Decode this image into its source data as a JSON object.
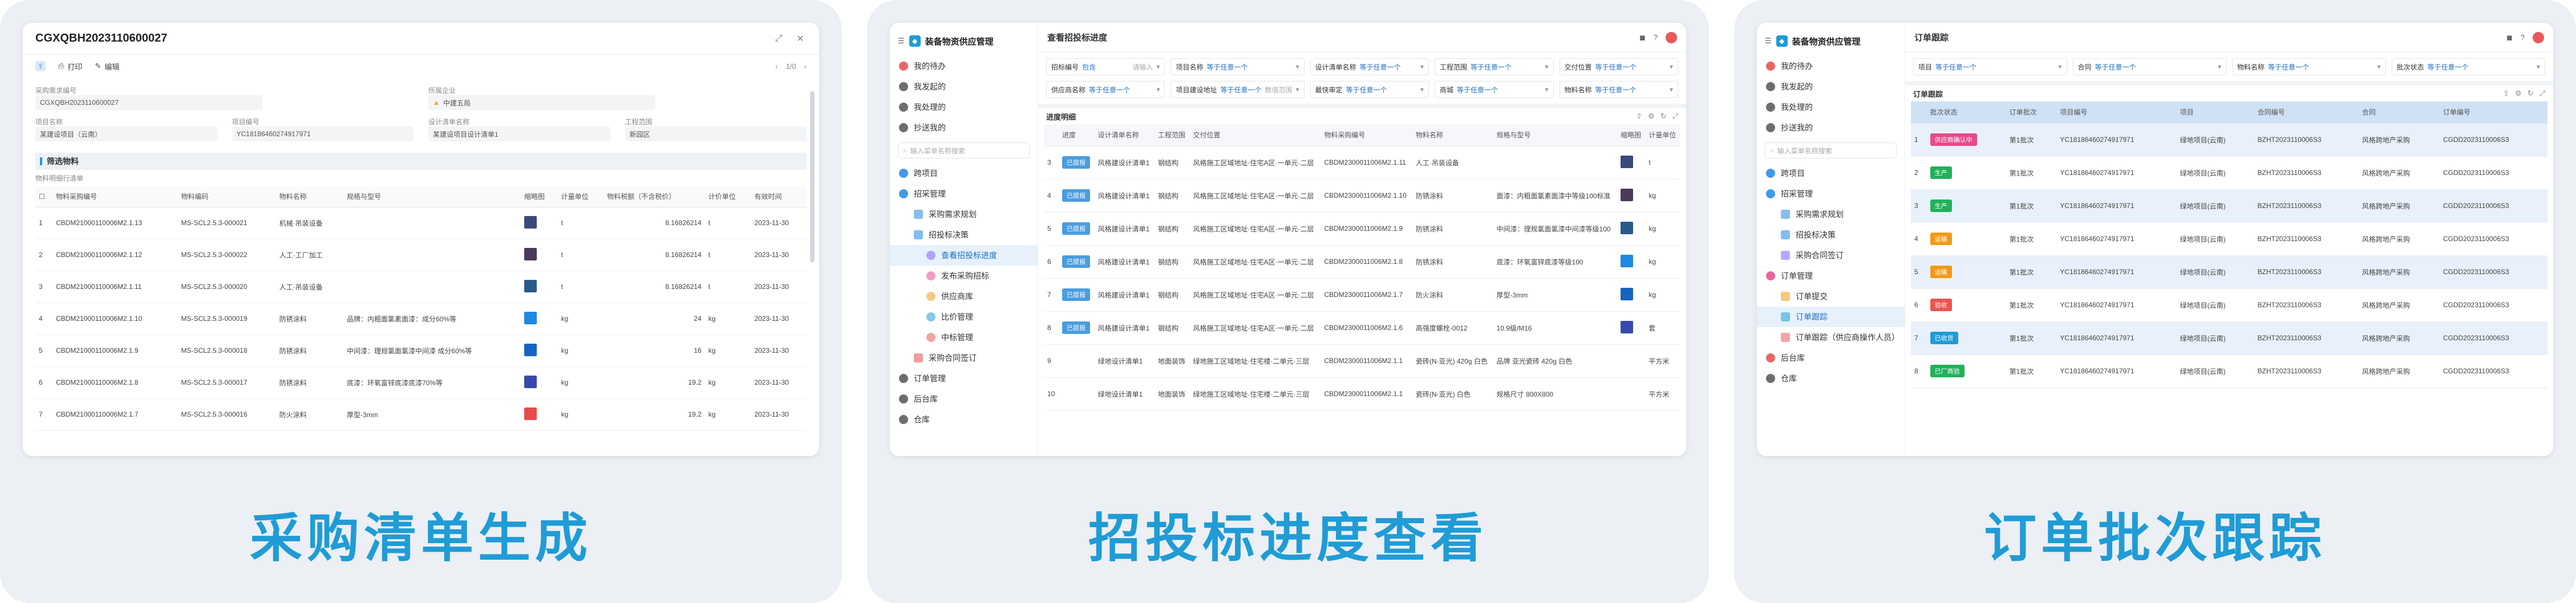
{
  "captions": {
    "p1": "采购清单生成",
    "p2": "招投标进度查看",
    "p3": "订单批次跟踪"
  },
  "colors": {
    "caption": "#1f9cd6",
    "accent": "#1f9cd6"
  },
  "p1": {
    "title": "CGXQBH2023110600027",
    "toolbar": {
      "print": "打印",
      "edit": "编辑",
      "pager": "1/0"
    },
    "fields": [
      {
        "label": "采购需求编号",
        "value": "CGXQBH2023110600027"
      },
      {
        "label": "所属企业",
        "value": "中建五局"
      },
      {
        "label": "项目名称",
        "value": "某建设项目（云南）"
      },
      {
        "label": "项目编号",
        "value": "YC18186460274917971"
      },
      {
        "label": "设计清单名称",
        "value": "某建设项目设计清单1"
      },
      {
        "label": "工程范围",
        "value": "新园区"
      }
    ],
    "section": "筛选物料",
    "list_label": "物料明细行清单",
    "columns": [
      "物料采购编号",
      "物料编码",
      "物料名称",
      "规格与型号",
      "缩略图",
      "计量单位",
      "物料税额（不含税价）",
      "计价单位",
      "有效时间"
    ],
    "rows": [
      {
        "no": "1",
        "code": "CBDM21000110006M2.1.13",
        "mcode": "MS-SCL2.5.3-000021",
        "name": "机械·吊装设备",
        "spec": "",
        "unit": "t",
        "amt": "8.16826214",
        "pu": "t",
        "date": "2023-11-30"
      },
      {
        "no": "2",
        "code": "CBDM21000110006M2.1.12",
        "mcode": "MS-SCL2.5.3-000022",
        "name": "人工·工厂加工",
        "spec": "",
        "unit": "t",
        "amt": "8.16826214",
        "pu": "t",
        "date": "2023-11-30"
      },
      {
        "no": "3",
        "code": "CBDM21000110006M2.1.11",
        "mcode": "MS-SCL2.5.3-000020",
        "name": "人工·吊装设备",
        "spec": "",
        "unit": "t",
        "amt": "8.16826214",
        "pu": "t",
        "date": "2023-11-30"
      },
      {
        "no": "4",
        "code": "CBDM21000110006M2.1.10",
        "mcode": "MS-SCL2.5.3-000019",
        "name": "防锈涂料",
        "spec": "品牌：内粗面氯素面漆：成分60%等",
        "unit": "kg",
        "amt": "24",
        "pu": "kg",
        "date": "2023-11-30"
      },
      {
        "no": "5",
        "code": "CBDM21000110006M2.1.9",
        "mcode": "MS-SCL2.5.3-000018",
        "name": "防锈涂料",
        "spec": "中间漆：理规氯面氯漆中间漆 成分60%等",
        "unit": "kg",
        "amt": "16",
        "pu": "kg",
        "date": "2023-11-30"
      },
      {
        "no": "6",
        "code": "CBDM21000110006M2.1.8",
        "mcode": "MS-SCL2.5.3-000017",
        "name": "防锈涂料",
        "spec": "底漆：环氧富锌底漆底漆70%等",
        "unit": "kg",
        "amt": "19.2",
        "pu": "kg",
        "date": "2023-11-30"
      },
      {
        "no": "7",
        "code": "CBDM21000110006M2.1.7",
        "mcode": "MS-SCL2.5.3-000016",
        "name": "防火涂料",
        "spec": "厚型-3mm",
        "unit": "kg",
        "amt": "19.2",
        "pu": "kg",
        "date": "2023-11-30"
      }
    ]
  },
  "p2": {
    "app": "装备物资供应管理",
    "page": "查看招投标进度",
    "nav": [
      {
        "label": "我的待办",
        "lvl": 0
      },
      {
        "label": "我发起的",
        "lvl": 0
      },
      {
        "label": "我处理的",
        "lvl": 0
      },
      {
        "label": "抄送我的",
        "lvl": 0
      },
      {
        "label": "跨项目",
        "lvl": 0
      },
      {
        "label": "招采管理",
        "lvl": 0
      },
      {
        "label": "采购需求规划",
        "lvl": 1
      },
      {
        "label": "招投标决策",
        "lvl": 1
      },
      {
        "label": "查看招投标进度",
        "lvl": 2,
        "active": true
      },
      {
        "label": "发布采购招标",
        "lvl": 2
      },
      {
        "label": "供应商库",
        "lvl": 2
      },
      {
        "label": "比价管理",
        "lvl": 2
      },
      {
        "label": "中标管理",
        "lvl": 2
      },
      {
        "label": "采购合同签订",
        "lvl": 1
      },
      {
        "label": "订单管理",
        "lvl": 0
      },
      {
        "label": "后台库",
        "lvl": 0
      },
      {
        "label": "仓库",
        "lvl": 0
      }
    ],
    "search_ph": "输入菜单名称搜索",
    "filters": [
      {
        "l": "招标编号",
        "o": "包含",
        "v": "请输入"
      },
      {
        "l": "项目名称",
        "o": "等于任意一个",
        "v": ""
      },
      {
        "l": "设计清单名称",
        "o": "等于任意一个",
        "v": ""
      },
      {
        "l": "工程范围",
        "o": "等于任意一个",
        "v": ""
      },
      {
        "l": "交付位置",
        "o": "等于任意一个",
        "v": ""
      },
      {
        "l": "供应商名称",
        "o": "等于任意一个",
        "v": ""
      },
      {
        "l": "项目建设地址",
        "o": "等于任意一个",
        "v": "数值范围"
      },
      {
        "l": "最快审定",
        "o": "等于任意一个",
        "v": ""
      },
      {
        "l": "商城",
        "o": "等于任意一个",
        "v": ""
      },
      {
        "l": "物料名称",
        "o": "等于任意一个",
        "v": ""
      }
    ],
    "sub": "进度明细",
    "columns": [
      "",
      "进度",
      "设计清单名称",
      "工程范围",
      "交付位置",
      "物料采购编号",
      "物料名称",
      "规格与型号",
      "缩略图",
      "计量单位"
    ],
    "rows": [
      {
        "n": "3",
        "st": "已提报",
        "d": "风格建设计清单1",
        "r": "钢结构",
        "loc": "风格施工区域地址·住宅A区·一单元·二层",
        "c": "CBDM2300011006M2.1.11",
        "m": "人工·吊装设备",
        "s": "",
        "u": "t"
      },
      {
        "n": "4",
        "st": "已提报",
        "d": "风格建设计清单1",
        "r": "钢结构",
        "loc": "风格施工区域地址·住宅A区·一单元·二层",
        "c": "CBDM2300011006M2.1.10",
        "m": "防锈涂料",
        "s": "面漆：内粗面氯素面漆中等级100标准",
        "u": "kg"
      },
      {
        "n": "5",
        "st": "已提报",
        "d": "风格建设计清单1",
        "r": "钢结构",
        "loc": "风格施工区域地址·住宅A区·一单元·二层",
        "c": "CBDM2300011006M2.1.9",
        "m": "防锈涂料",
        "s": "中间漆：理规氯面氯漆中间漆等级100",
        "u": "kg"
      },
      {
        "n": "6",
        "st": "已提报",
        "d": "风格建设计清单1",
        "r": "钢结构",
        "loc": "风格施工区域地址·住宅A区·一单元·二层",
        "c": "CBDM2300011006M2.1.8",
        "m": "防锈涂料",
        "s": "底漆：环氧富锌底漆等级100",
        "u": "kg"
      },
      {
        "n": "7",
        "st": "已提报",
        "d": "风格建设计清单1",
        "r": "钢结构",
        "loc": "风格施工区域地址·住宅A区·一单元·二层",
        "c": "CBDM2300011006M2.1.7",
        "m": "防火涂料",
        "s": "厚型-3mm",
        "u": "kg"
      },
      {
        "n": "8",
        "st": "已提报",
        "d": "风格建设计清单1",
        "r": "钢结构",
        "loc": "风格施工区域地址·住宅A区·一单元·二层",
        "c": "CBDM2300011006M2.1.6",
        "m": "高强度螺栓-0012",
        "s": "10.9级/M16",
        "u": "套"
      },
      {
        "n": "9",
        "st": "",
        "d": "绿地设计清单1",
        "r": "地面装饰",
        "loc": "绿地施工区域地址·住宅楼·二单元·三层",
        "c": "CBDM2300011006M2.1.1",
        "m": "瓷砖(N-亚光) 420g 白色",
        "s": "品牌 亚光瓷砖 420g 白色",
        "u": "平方米"
      },
      {
        "n": "10",
        "st": "",
        "d": "绿地设计清单1",
        "r": "地面装饰",
        "loc": "绿地施工区域地址·住宅楼·二单元·三层",
        "c": "CBDM2300011006M2.1.1",
        "m": "瓷砖(N-亚光) 白色 ",
        "s": "规格尺寸 800X800",
        "u": "平方米"
      }
    ]
  },
  "p3": {
    "app": "装备物资供应管理",
    "page": "订单跟踪",
    "nav": [
      {
        "label": "我的待办",
        "lvl": 0
      },
      {
        "label": "我发起的",
        "lvl": 0
      },
      {
        "label": "我处理的",
        "lvl": 0
      },
      {
        "label": "抄送我的",
        "lvl": 0
      },
      {
        "label": "跨项目",
        "lvl": 0
      },
      {
        "label": "招采管理",
        "lvl": 0
      },
      {
        "label": "采购需求规划",
        "lvl": 1
      },
      {
        "label": "招投标决策",
        "lvl": 1
      },
      {
        "label": "采购合同签订",
        "lvl": 1
      },
      {
        "label": "订单管理",
        "lvl": 0
      },
      {
        "label": "订单提交",
        "lvl": 1
      },
      {
        "label": "订单跟踪",
        "lvl": 1,
        "active": true
      },
      {
        "label": "订单跟踪（供应商操作人员）",
        "lvl": 1
      },
      {
        "label": "后台库",
        "lvl": 0
      },
      {
        "label": "仓库",
        "lvl": 0
      }
    ],
    "search_ph": "输入菜单名称搜索",
    "filters": [
      {
        "l": "项目",
        "o": "等于任意一个",
        "v": ""
      },
      {
        "l": "合同",
        "o": "等于任意一个",
        "v": ""
      },
      {
        "l": "物料名称",
        "o": "等于任意一个",
        "v": ""
      },
      {
        "l": "批次状态",
        "o": "等于任意一个",
        "v": ""
      }
    ],
    "sub": "订单跟踪",
    "columns": [
      "",
      "批次状态",
      "订单批次",
      "项目编号",
      "项目",
      "合同编号",
      "合同",
      "订单编号"
    ],
    "rows": [
      {
        "n": "1",
        "st": "供应商确认中",
        "c": "#e64b8c",
        "b": "第1批次",
        "pc": "YC18186460274917971",
        "p": "绿地项目(云南)",
        "hc": "BZHT2023110006S3",
        "h": "风格跨地产采购",
        "oc": "CGDD2023110006S3"
      },
      {
        "n": "2",
        "st": "生产",
        "c": "#21b15a",
        "b": "第1批次",
        "pc": "YC18186460274917971",
        "p": "绿地项目(云南)",
        "hc": "BZHT2023110006S3",
        "h": "风格跨地产采购",
        "oc": "CGDD2023110006S3"
      },
      {
        "n": "3",
        "st": "生产",
        "c": "#21b15a",
        "b": "第1批次",
        "pc": "YC18186460274917971",
        "p": "绿地项目(云南)",
        "hc": "BZHT2023110006S3",
        "h": "风格跨地产采购",
        "oc": "CGDD2023110006S3"
      },
      {
        "n": "4",
        "st": "运输",
        "c": "#f29a17",
        "b": "第1批次",
        "pc": "YC18186460274917971",
        "p": "绿地项目(云南)",
        "hc": "BZHT2023110006S3",
        "h": "风格跨地产采购",
        "oc": "CGDD2023110006S3"
      },
      {
        "n": "5",
        "st": "运输",
        "c": "#f29a17",
        "b": "第1批次",
        "pc": "YC18186460274917971",
        "p": "绿地项目(云南)",
        "hc": "BZHT2023110006S3",
        "h": "风格跨地产采购",
        "oc": "CGDD2023110006S3"
      },
      {
        "n": "6",
        "st": "验收",
        "c": "#ef5350",
        "b": "第1批次",
        "pc": "YC18186460274917971",
        "p": "绿地项目(云南)",
        "hc": "BZHT2023110006S3",
        "h": "风格跨地产采购",
        "oc": "CGDD2023110006S3"
      },
      {
        "n": "7",
        "st": "已收货",
        "c": "#1f9cd6",
        "b": "第1批次",
        "pc": "YC18186460274917971",
        "p": "绿地项目(云南)",
        "hc": "BZHT2023110006S3",
        "h": "风格跨地产采购",
        "oc": "CGDD2023110006S3"
      },
      {
        "n": "8",
        "st": "已厂商验",
        "c": "#21b15a",
        "b": "第1批次",
        "pc": "YC18186460274917971",
        "p": "绿地项目(云南)",
        "hc": "BZHT2023110006S3",
        "h": "风格跨地产采购",
        "oc": "CGDD2023110006S3"
      }
    ]
  }
}
